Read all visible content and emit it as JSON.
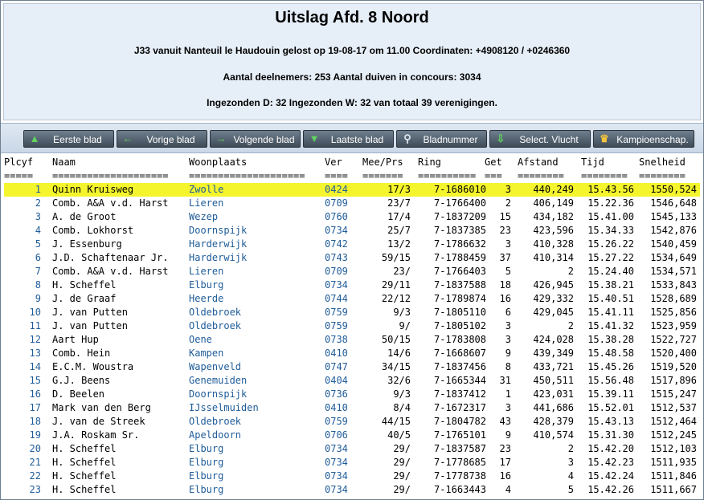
{
  "header": {
    "title": "Uitslag Afd. 8 Noord",
    "line1": "J33 vanuit Nanteuil le Haudouin gelost op 19-08-17 om 11.00 Coordinaten: +4908120 / +0246360",
    "line2": "Aantal deelnemers: 253 Aantal duiven in concours: 3034",
    "line3": "Ingezonden D: 32 Ingezonden W: 32 van totaal 39 verenigingen."
  },
  "toolbar": [
    {
      "label": "Eerste blad",
      "icon": "arrow-up-icon"
    },
    {
      "label": "Vorige blad",
      "icon": "arrow-left-icon"
    },
    {
      "label": "Volgende blad",
      "icon": "arrow-right-icon"
    },
    {
      "label": "Laatste blad",
      "icon": "arrow-down-icon"
    },
    {
      "label": "Bladnummer",
      "icon": "search-icon"
    },
    {
      "label": "Select. Vlucht",
      "icon": "download-icon"
    },
    {
      "label": "Kampioenschap.",
      "icon": "crown-icon"
    }
  ],
  "columns": {
    "plc": "Plcyf",
    "naam": "Naam",
    "woon": "Woonplaats",
    "ver": "Ver",
    "mee": "Mee/Prs",
    "ring": "Ring",
    "get": "Get",
    "afs": "Afstand",
    "tijd": "Tijd",
    "snel": "Snelheid"
  },
  "separators": {
    "plc": "=====",
    "naam": "====================",
    "woon": "====================",
    "ver": "====",
    "mee": "=======",
    "ring": "==========",
    "get": "===",
    "afs": "========",
    "tijd": "========",
    "snel": "========"
  },
  "rows": [
    {
      "plc": "1",
      "naam": "Quinn Kruisweg",
      "woon": "Zwolle",
      "ver": "0424",
      "mee": "17/3",
      "ring": "7-1686010",
      "get": "3",
      "afs": "440,249",
      "tijd": "15.43.56",
      "snel": "1550,524"
    },
    {
      "plc": "2",
      "naam": "Comb. A&A v.d. Harst",
      "woon": "Lieren",
      "ver": "0709",
      "mee": "23/7",
      "ring": "7-1766400",
      "get": "2",
      "afs": "406,149",
      "tijd": "15.22.36",
      "snel": "1546,648"
    },
    {
      "plc": "3",
      "naam": "A. de Groot",
      "woon": "Wezep",
      "ver": "0760",
      "mee": "17/4",
      "ring": "7-1837209",
      "get": "15",
      "afs": "434,182",
      "tijd": "15.41.00",
      "snel": "1545,133"
    },
    {
      "plc": "4",
      "naam": "Comb. Lokhorst",
      "woon": "Doornspijk",
      "ver": "0734",
      "mee": "25/7",
      "ring": "7-1837385",
      "get": "23",
      "afs": "423,596",
      "tijd": "15.34.33",
      "snel": "1542,876"
    },
    {
      "plc": "5",
      "naam": "J. Essenburg",
      "woon": "Harderwijk",
      "ver": "0742",
      "mee": "13/2",
      "ring": "7-1786632",
      "get": "3",
      "afs": "410,328",
      "tijd": "15.26.22",
      "snel": "1540,459"
    },
    {
      "plc": "6",
      "naam": "J.D. Schaftenaar Jr.",
      "woon": "Harderwijk",
      "ver": "0743",
      "mee": "59/15",
      "ring": "7-1788459",
      "get": "37",
      "afs": "410,314",
      "tijd": "15.27.22",
      "snel": "1534,649"
    },
    {
      "plc": "7",
      "naam": "Comb. A&A v.d. Harst",
      "woon": "Lieren",
      "ver": "0709",
      "mee": "23/",
      "ring": "7-1766403",
      "get": "5",
      "afs": "2",
      "tijd": "15.24.40",
      "snel": "1534,571"
    },
    {
      "plc": "8",
      "naam": "H. Scheffel",
      "woon": "Elburg",
      "ver": "0734",
      "mee": "29/11",
      "ring": "7-1837588",
      "get": "18",
      "afs": "426,945",
      "tijd": "15.38.21",
      "snel": "1533,843"
    },
    {
      "plc": "9",
      "naam": "J. de Graaf",
      "woon": "Heerde",
      "ver": "0744",
      "mee": "22/12",
      "ring": "7-1789874",
      "get": "16",
      "afs": "429,332",
      "tijd": "15.40.51",
      "snel": "1528,689"
    },
    {
      "plc": "10",
      "naam": "J. van Putten",
      "woon": "Oldebroek",
      "ver": "0759",
      "mee": "9/3",
      "ring": "7-1805110",
      "get": "6",
      "afs": "429,045",
      "tijd": "15.41.11",
      "snel": "1525,856"
    },
    {
      "plc": "11",
      "naam": "J. van Putten",
      "woon": "Oldebroek",
      "ver": "0759",
      "mee": "9/",
      "ring": "7-1805102",
      "get": "3",
      "afs": "2",
      "tijd": "15.41.32",
      "snel": "1523,959"
    },
    {
      "plc": "12",
      "naam": "Aart Hup",
      "woon": "Oene",
      "ver": "0738",
      "mee": "50/15",
      "ring": "7-1783808",
      "get": "3",
      "afs": "424,028",
      "tijd": "15.38.28",
      "snel": "1522,727"
    },
    {
      "plc": "13",
      "naam": "Comb. Hein",
      "woon": "Kampen",
      "ver": "0410",
      "mee": "14/6",
      "ring": "7-1668607",
      "get": "9",
      "afs": "439,349",
      "tijd": "15.48.58",
      "snel": "1520,400"
    },
    {
      "plc": "14",
      "naam": "E.C.M. Woustra",
      "woon": "Wapenveld",
      "ver": "0747",
      "mee": "34/15",
      "ring": "7-1837456",
      "get": "8",
      "afs": "433,721",
      "tijd": "15.45.26",
      "snel": "1519,520"
    },
    {
      "plc": "15",
      "naam": "G.J. Beens",
      "woon": "Genemuiden",
      "ver": "0404",
      "mee": "32/6",
      "ring": "7-1665344",
      "get": "31",
      "afs": "450,511",
      "tijd": "15.56.48",
      "snel": "1517,896"
    },
    {
      "plc": "16",
      "naam": "D. Beelen",
      "woon": "Doornspijk",
      "ver": "0736",
      "mee": "9/3",
      "ring": "7-1837412",
      "get": "1",
      "afs": "423,031",
      "tijd": "15.39.11",
      "snel": "1515,247"
    },
    {
      "plc": "17",
      "naam": "Mark van den Berg",
      "woon": "IJsselmuiden",
      "ver": "0410",
      "mee": "8/4",
      "ring": "7-1672317",
      "get": "3",
      "afs": "441,686",
      "tijd": "15.52.01",
      "snel": "1512,537"
    },
    {
      "plc": "18",
      "naam": "J. van de Streek",
      "woon": "Oldebroek",
      "ver": "0759",
      "mee": "44/15",
      "ring": "7-1804782",
      "get": "43",
      "afs": "428,379",
      "tijd": "15.43.13",
      "snel": "1512,464"
    },
    {
      "plc": "19",
      "naam": "J.A. Roskam Sr.",
      "woon": "Apeldoorn",
      "ver": "0706",
      "mee": "40/5",
      "ring": "7-1765101",
      "get": "9",
      "afs": "410,574",
      "tijd": "15.31.30",
      "snel": "1512,245"
    },
    {
      "plc": "20",
      "naam": "H. Scheffel",
      "woon": "Elburg",
      "ver": "0734",
      "mee": "29/",
      "ring": "7-1837587",
      "get": "23",
      "afs": "2",
      "tijd": "15.42.20",
      "snel": "1512,103"
    },
    {
      "plc": "21",
      "naam": "H. Scheffel",
      "woon": "Elburg",
      "ver": "0734",
      "mee": "29/",
      "ring": "7-1778685",
      "get": "17",
      "afs": "3",
      "tijd": "15.42.23",
      "snel": "1511,935"
    },
    {
      "plc": "22",
      "naam": "H. Scheffel",
      "woon": "Elburg",
      "ver": "0734",
      "mee": "29/",
      "ring": "7-1778738",
      "get": "16",
      "afs": "4",
      "tijd": "15.42.24",
      "snel": "1511,846"
    },
    {
      "plc": "23",
      "naam": "H. Scheffel",
      "woon": "Elburg",
      "ver": "0734",
      "mee": "29/",
      "ring": "7-1663443",
      "get": "4",
      "afs": "5",
      "tijd": "15.42.26",
      "snel": "1511,667"
    }
  ],
  "highlighted_row": 1,
  "colors": {
    "highlight": "#f5f52e",
    "link_blue": "#1f5c99",
    "header_bg": "#e6eef7",
    "button_bg": "#4d5a67"
  }
}
